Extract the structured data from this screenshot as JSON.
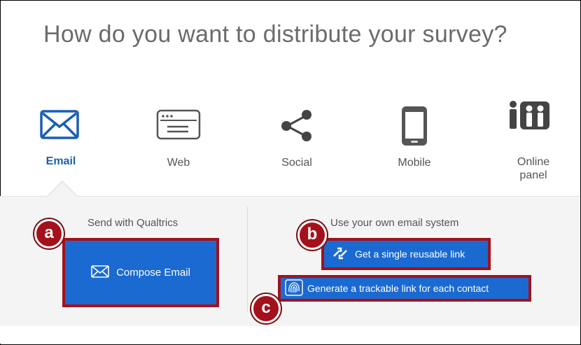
{
  "page": {
    "title": "How do you want to distribute your survey?"
  },
  "tabs": [
    {
      "label": "Email",
      "icon": "envelope-icon"
    },
    {
      "label": "Web",
      "icon": "web-page-icon"
    },
    {
      "label": "Social",
      "icon": "share-icon"
    },
    {
      "label": "Mobile",
      "icon": "mobile-phone-icon"
    },
    {
      "label": "Online\npanel",
      "icon": "people-panel-icon"
    }
  ],
  "qualtrics": {
    "heading": "Send with Qualtrics",
    "compose_label": "Compose Email"
  },
  "own_system": {
    "heading": "Use your own email system",
    "reusable_link_label": "Get a single reusable link",
    "trackable_link_label": "Generate a trackable link for each contact"
  },
  "markers": {
    "a": "a",
    "b": "b",
    "c": "c"
  },
  "colors": {
    "accent": "#1b6ad1",
    "highlight": "#a4111b",
    "panel": "#f4f4f4"
  }
}
